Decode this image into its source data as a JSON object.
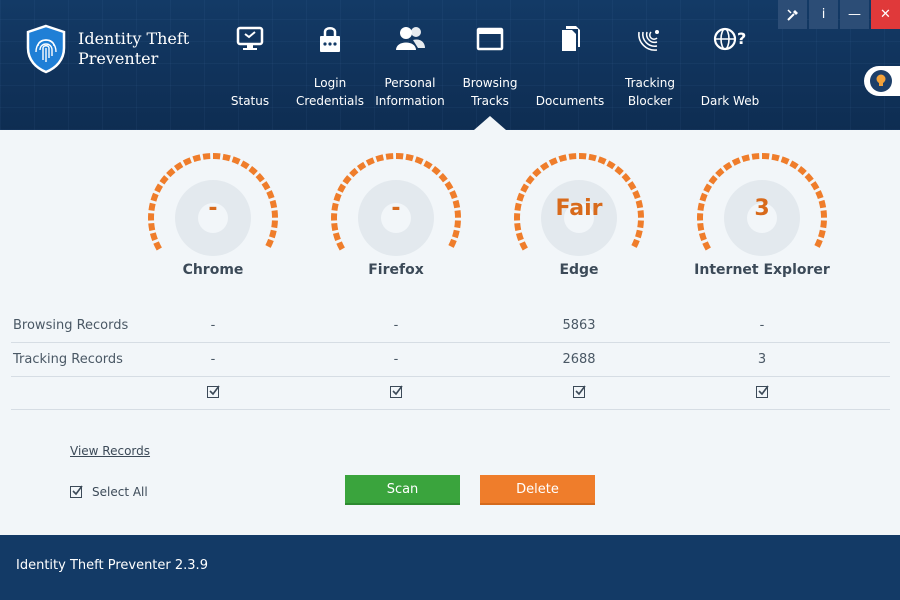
{
  "app": {
    "title": "Identity Theft Preventer",
    "version_text": "Identity Theft Preventer 2.3.9"
  },
  "window_controls": {
    "tools": "",
    "info": "i",
    "minimize": "—",
    "close": "✕"
  },
  "nav": [
    {
      "label": "Status",
      "icon": "monitor-icon"
    },
    {
      "label": "Login\nCredentials",
      "icon": "lock-password-icon"
    },
    {
      "label": "Personal\nInformation",
      "icon": "users-icon"
    },
    {
      "label": "Browsing\nTracks",
      "icon": "browser-window-icon",
      "active": true
    },
    {
      "label": "Documents",
      "icon": "documents-icon"
    },
    {
      "label": "Tracking\nBlocker",
      "icon": "radar-icon"
    },
    {
      "label": "Dark Web",
      "icon": "globe-question-icon"
    }
  ],
  "gauges": [
    {
      "browser": "Chrome",
      "value": "-",
      "icon": "chrome-icon"
    },
    {
      "browser": "Firefox",
      "value": "-",
      "icon": "firefox-icon"
    },
    {
      "browser": "Edge",
      "value": "Fair",
      "icon": "edge-icon"
    },
    {
      "browser": "Internet Explorer",
      "value": "3",
      "icon": "ie-icon"
    }
  ],
  "table": {
    "rows": [
      {
        "label": "Browsing Records",
        "values": [
          "-",
          "-",
          "5863",
          "-"
        ]
      },
      {
        "label": "Tracking Records",
        "values": [
          "-",
          "-",
          "2688",
          "3"
        ]
      }
    ],
    "checkboxes": [
      true,
      true,
      true,
      true
    ]
  },
  "links": {
    "view_records": "View Records"
  },
  "select_all": {
    "label": "Select All",
    "checked": true
  },
  "buttons": {
    "scan": "Scan",
    "delete": "Delete"
  },
  "colors": {
    "accent_orange": "#ef7d2b",
    "scan_green": "#3aa43d",
    "header_navy": "#133a66",
    "close_red": "#e0393a"
  }
}
